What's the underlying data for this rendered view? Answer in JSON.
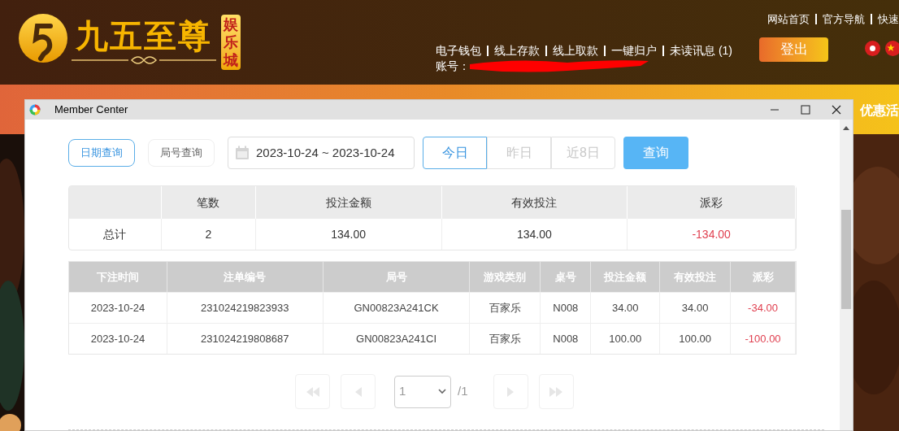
{
  "header": {
    "logo": {
      "name": "九五至尊",
      "badge": "娱乐城"
    },
    "top_links": [
      "网站首页",
      "官方导航",
      "快速"
    ],
    "nav_links": [
      "电子钱包",
      "线上存款",
      "线上取款",
      "一键归户",
      "未读讯息 (1)"
    ],
    "account_label": "账号：",
    "logout": "登出"
  },
  "promo_bar": {
    "text": "优惠活"
  },
  "window": {
    "title": "Member Center",
    "tabs": [
      {
        "label": "日期查询",
        "selected": true
      },
      {
        "label": "局号查询",
        "selected": false
      }
    ],
    "date_range": "2023-10-24 ~ 2023-10-24",
    "quick_ranges": [
      {
        "label": "今日",
        "selected": true
      },
      {
        "label": "昨日",
        "selected": false
      },
      {
        "label": "近8日",
        "selected": false
      }
    ],
    "query_button": "查询",
    "summary": {
      "columns": [
        "笔数",
        "投注金额",
        "有效投注",
        "派彩"
      ],
      "row": {
        "label": "总计",
        "cells": [
          "2",
          "134.00",
          "134.00",
          "-134.00"
        ],
        "negative": true
      }
    },
    "details": {
      "columns": [
        "下注时间",
        "注单编号",
        "局号",
        "游戏类别",
        "桌号",
        "投注金额",
        "有效投注",
        "派彩"
      ],
      "rows": [
        {
          "cells": [
            "2023-10-24",
            "231024219823933",
            "GN00823A241CK",
            "百家乐",
            "N008",
            "34.00",
            "34.00",
            "-34.00"
          ],
          "negative": true
        },
        {
          "cells": [
            "2023-10-24",
            "231024219808687",
            "GN00823A241CI",
            "百家乐",
            "N008",
            "100.00",
            "100.00",
            "-100.00"
          ],
          "negative": true
        }
      ]
    },
    "pagination": {
      "buttons": [
        {
          "kind": "first",
          "disabled": true
        },
        {
          "kind": "prev",
          "disabled": true
        },
        {
          "kind": "next",
          "disabled": true
        },
        {
          "kind": "last",
          "disabled": true
        }
      ],
      "page": "1",
      "total": "/1"
    }
  }
}
